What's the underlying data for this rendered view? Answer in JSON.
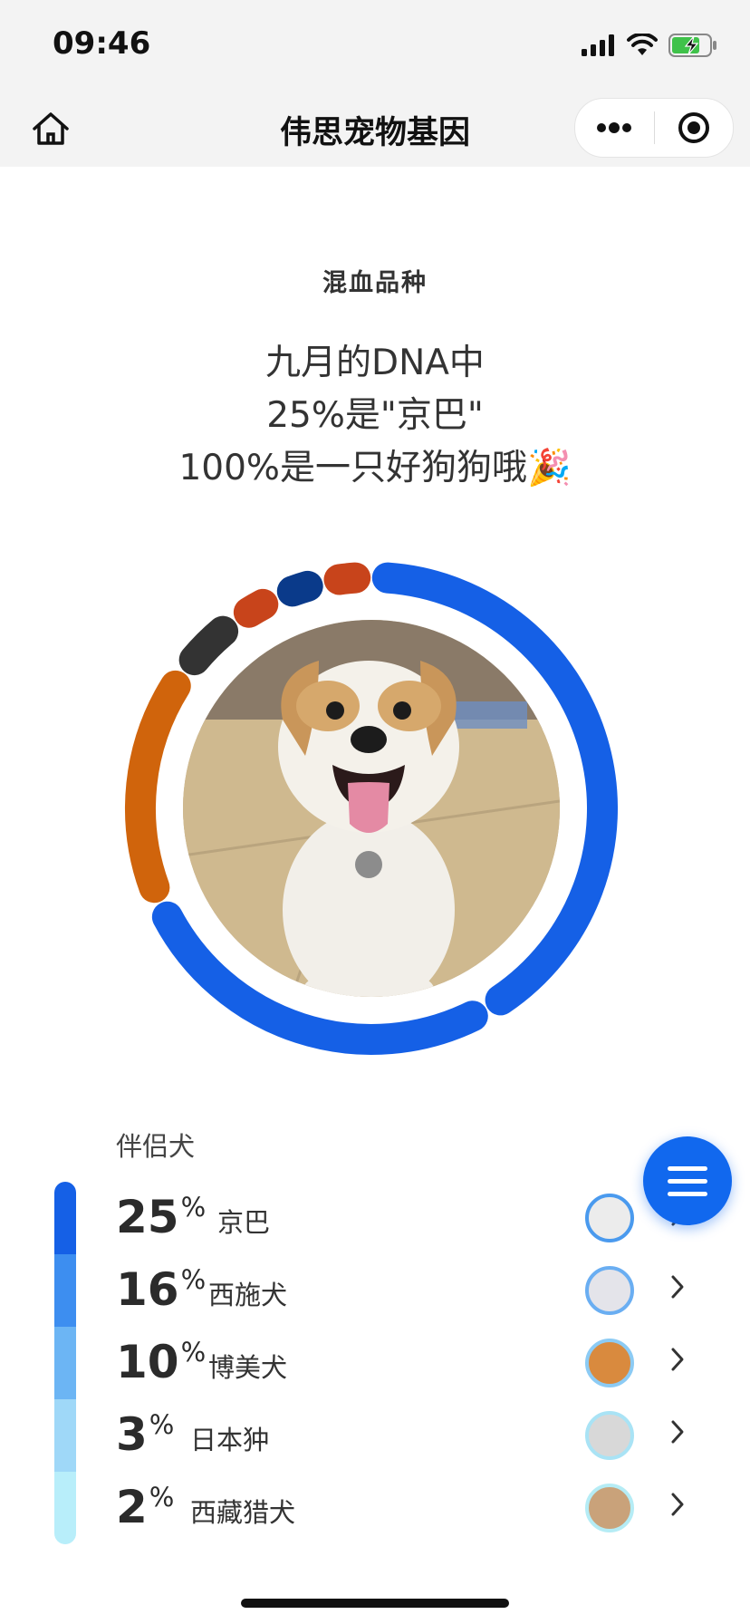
{
  "status_bar": {
    "time": "09:46",
    "icons": [
      "signal-icon",
      "wifi-icon",
      "battery-charging-icon"
    ]
  },
  "nav": {
    "title": "伟思宠物基因",
    "left_icon": "home-icon",
    "capsule_icons": [
      "more-dots-icon",
      "target-circle-icon"
    ]
  },
  "section_title": "混血品种",
  "headline": {
    "line1": "九月的DNA中",
    "line2": "25%是\"京巴\"",
    "line3": "100%是一只好狗狗哦🎉"
  },
  "ring": {
    "segments": [
      {
        "breed": "京巴",
        "share": 0.25,
        "color": "#1560e6"
      },
      {
        "breed": "西施犬",
        "share": 0.16,
        "color": "#1560e6"
      },
      {
        "breed": "博美犬",
        "share": 0.1,
        "color": "#d0640c"
      },
      {
        "breed": "日本狆",
        "share": 0.03,
        "color": "#333333"
      },
      {
        "breed": "西藏猎犬",
        "share": 0.02,
        "color": "#c8441b"
      },
      {
        "breed": "other",
        "share": 0.02,
        "color": "#0a3a8a"
      },
      {
        "breed": "other",
        "share": 0.02,
        "color": "#c8441b"
      }
    ]
  },
  "group": {
    "title": "伴侣犬",
    "bar_colors": [
      "#1560e6",
      "#3d8ef0",
      "#6cb5f4",
      "#9fd8f8",
      "#b8eefa"
    ],
    "breeds": [
      {
        "pct": "25",
        "symbol": "%",
        "name": "京巴",
        "avatar_color": "#4a9aee"
      },
      {
        "pct": "16",
        "symbol": "%",
        "name": "西施犬",
        "avatar_color": "#6aaef2"
      },
      {
        "pct": "10",
        "symbol": "%",
        "name": "博美犬",
        "avatar_color": "#8ccbf4"
      },
      {
        "pct": "3",
        "symbol": "%",
        "name": "日本狆",
        "avatar_color": "#a9e3f5"
      },
      {
        "pct": "2",
        "symbol": "%",
        "name": "西藏猎犬",
        "avatar_color": "#b5ecf5"
      }
    ]
  },
  "fab": {
    "icon": "menu-icon"
  }
}
